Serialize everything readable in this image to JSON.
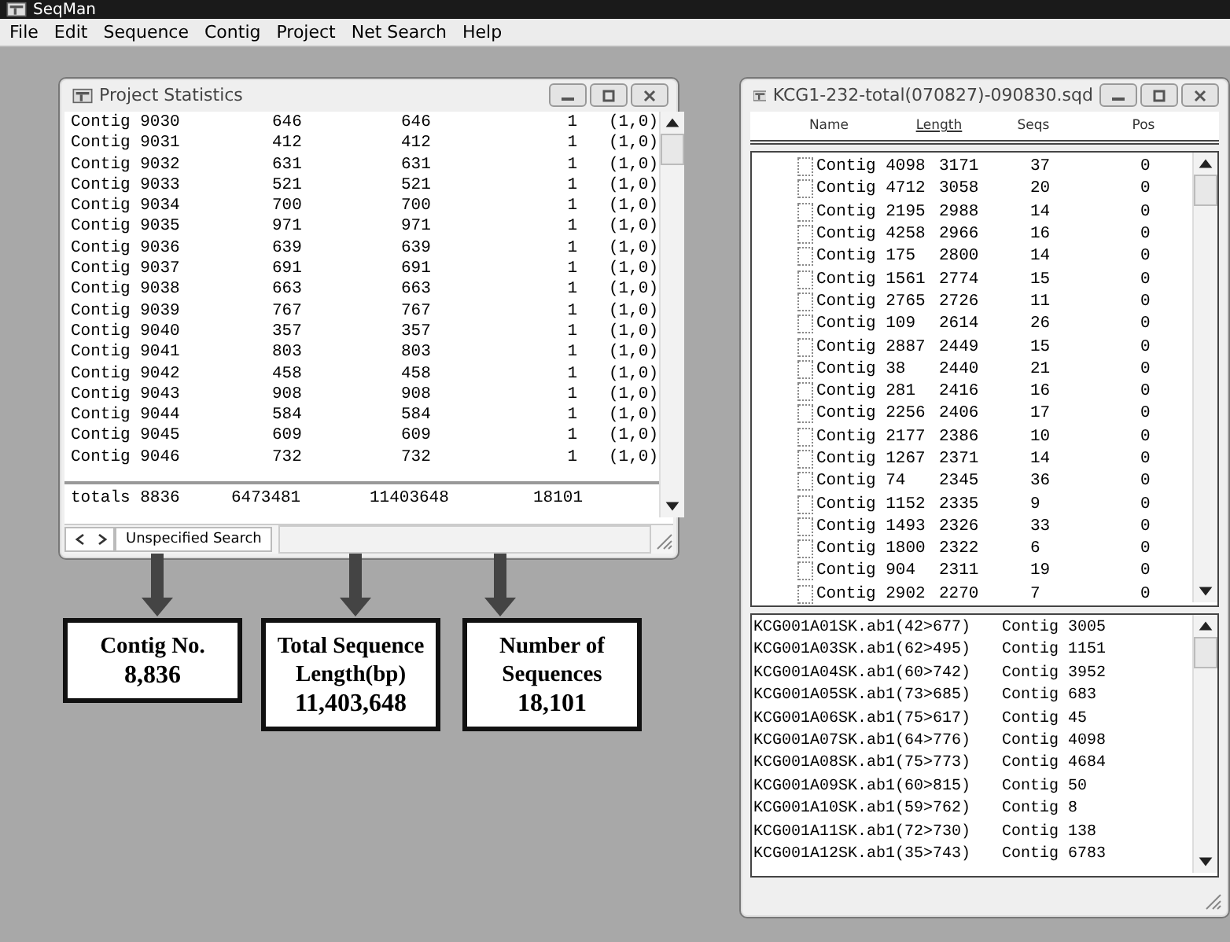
{
  "app": {
    "title": "SeqMan"
  },
  "menu": [
    "File",
    "Edit",
    "Sequence",
    "Contig",
    "Project",
    "Net Search",
    "Help"
  ],
  "stats_window": {
    "title": "Project Statistics",
    "rows": [
      [
        "Contig 9030",
        "646",
        "646",
        "1",
        "(1,0)"
      ],
      [
        "Contig 9031",
        "412",
        "412",
        "1",
        "(1,0)"
      ],
      [
        "Contig 9032",
        "631",
        "631",
        "1",
        "(1,0)"
      ],
      [
        "Contig 9033",
        "521",
        "521",
        "1",
        "(1,0)"
      ],
      [
        "Contig 9034",
        "700",
        "700",
        "1",
        "(1,0)"
      ],
      [
        "Contig 9035",
        "971",
        "971",
        "1",
        "(1,0)"
      ],
      [
        "Contig 9036",
        "639",
        "639",
        "1",
        "(1,0)"
      ],
      [
        "Contig 9037",
        "691",
        "691",
        "1",
        "(1,0)"
      ],
      [
        "Contig 9038",
        "663",
        "663",
        "1",
        "(1,0)"
      ],
      [
        "Contig 9039",
        "767",
        "767",
        "1",
        "(1,0)"
      ],
      [
        "Contig 9040",
        "357",
        "357",
        "1",
        "(1,0)"
      ],
      [
        "Contig 9041",
        "803",
        "803",
        "1",
        "(1,0)"
      ],
      [
        "Contig 9042",
        "458",
        "458",
        "1",
        "(1,0)"
      ],
      [
        "Contig 9043",
        "908",
        "908",
        "1",
        "(1,0)"
      ],
      [
        "Contig 9044",
        "584",
        "584",
        "1",
        "(1,0)"
      ],
      [
        "Contig 9045",
        "609",
        "609",
        "1",
        "(1,0)"
      ],
      [
        "Contig 9046",
        "732",
        "732",
        "1",
        "(1,0)"
      ]
    ],
    "totals": [
      "totals 8836",
      "6473481",
      "11403648",
      "18101"
    ],
    "tab": "Unspecified Search"
  },
  "contig_window": {
    "title": "KCG1-232-total(070827)-090830.sqd",
    "columns": [
      {
        "label": "Name",
        "sorted": false
      },
      {
        "label": "Length",
        "sorted": true
      },
      {
        "label": "Seqs",
        "sorted": false
      },
      {
        "label": "Pos",
        "sorted": false
      }
    ],
    "contigs": [
      {
        "cells": [
          "Contig 4098",
          "3171",
          "37",
          "0"
        ],
        "checked": false
      },
      {
        "cells": [
          "Contig 4712",
          "3058",
          "20",
          "0"
        ],
        "checked": false
      },
      {
        "cells": [
          "Contig 2195",
          "2988",
          "14",
          "0"
        ],
        "checked": false
      },
      {
        "cells": [
          "Contig 4258",
          "2966",
          "16",
          "0"
        ],
        "checked": false
      },
      {
        "cells": [
          "Contig 175",
          "2800",
          "14",
          "0"
        ],
        "checked": false
      },
      {
        "cells": [
          "Contig 1561",
          "2774",
          "15",
          "0"
        ],
        "checked": false
      },
      {
        "cells": [
          "Contig 2765",
          "2726",
          "11",
          "0"
        ],
        "checked": false
      },
      {
        "cells": [
          "Contig 109",
          "2614",
          "26",
          "0"
        ],
        "checked": false
      },
      {
        "cells": [
          "Contig 2887",
          "2449",
          "15",
          "0"
        ],
        "checked": false
      },
      {
        "cells": [
          "Contig 38",
          "2440",
          "21",
          "0"
        ],
        "checked": false
      },
      {
        "cells": [
          "Contig 281",
          "2416",
          "16",
          "0"
        ],
        "checked": false
      },
      {
        "cells": [
          "Contig 2256",
          "2406",
          "17",
          "0"
        ],
        "checked": false
      },
      {
        "cells": [
          "Contig 2177",
          "2386",
          "10",
          "0"
        ],
        "checked": false
      },
      {
        "cells": [
          "Contig 1267",
          "2371",
          "14",
          "0"
        ],
        "checked": false
      },
      {
        "cells": [
          "Contig 74",
          "2345",
          "36",
          "0"
        ],
        "checked": false
      },
      {
        "cells": [
          "Contig 1152",
          "2335",
          "9",
          "0"
        ],
        "checked": false
      },
      {
        "cells": [
          "Contig 1493",
          "2326",
          "33",
          "0"
        ],
        "checked": false
      },
      {
        "cells": [
          "Contig 1800",
          "2322",
          "6",
          "0"
        ],
        "checked": false
      },
      {
        "cells": [
          "Contig 904",
          "2311",
          "19",
          "0"
        ],
        "checked": false
      },
      {
        "cells": [
          "Contig 2902",
          "2270",
          "7",
          "0"
        ],
        "checked": false
      }
    ],
    "reads": [
      [
        "KCG001A01SK.ab1(42>677)",
        "Contig 3005"
      ],
      [
        "KCG001A03SK.ab1(62>495)",
        "Contig 1151"
      ],
      [
        "KCG001A04SK.ab1(60>742)",
        "Contig 3952"
      ],
      [
        "KCG001A05SK.ab1(73>685)",
        "Contig 683"
      ],
      [
        "KCG001A06SK.ab1(75>617)",
        "Contig 45"
      ],
      [
        "KCG001A07SK.ab1(64>776)",
        "Contig 4098"
      ],
      [
        "KCG001A08SK.ab1(75>773)",
        "Contig 4684"
      ],
      [
        "KCG001A09SK.ab1(60>815)",
        "Contig 50"
      ],
      [
        "KCG001A10SK.ab1(59>762)",
        "Contig 8"
      ],
      [
        "KCG001A11SK.ab1(72>730)",
        "Contig 138"
      ],
      [
        "KCG001A12SK.ab1(35>743)",
        "Contig 6783"
      ]
    ]
  },
  "annotations": [
    {
      "label": "Contig No.",
      "value": "8,836"
    },
    {
      "label": "Total Sequence Length(bp)",
      "value": "11,403,648"
    },
    {
      "label": "Number of Sequences",
      "value": "18,101"
    }
  ]
}
